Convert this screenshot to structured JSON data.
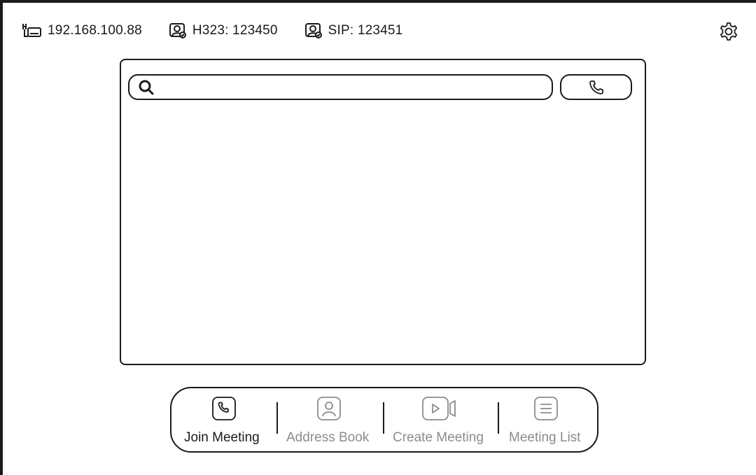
{
  "status_bar": {
    "ip_address": "192.168.100.88",
    "h323": "H323: 123450",
    "sip": "SIP: 123451"
  },
  "search": {
    "value": "",
    "placeholder": ""
  },
  "bottom_nav": {
    "items": [
      {
        "label": "Join Meeting",
        "icon": "phone-icon",
        "active": true
      },
      {
        "label": "Address Book",
        "icon": "contact-icon",
        "active": false
      },
      {
        "label": "Create Meeting",
        "icon": "video-camera-icon",
        "active": false
      },
      {
        "label": "Meeting List",
        "icon": "list-icon",
        "active": false
      }
    ]
  },
  "colors": {
    "foreground": "#1a1a1a",
    "inactive": "#8c8c8c",
    "background": "#ffffff"
  }
}
